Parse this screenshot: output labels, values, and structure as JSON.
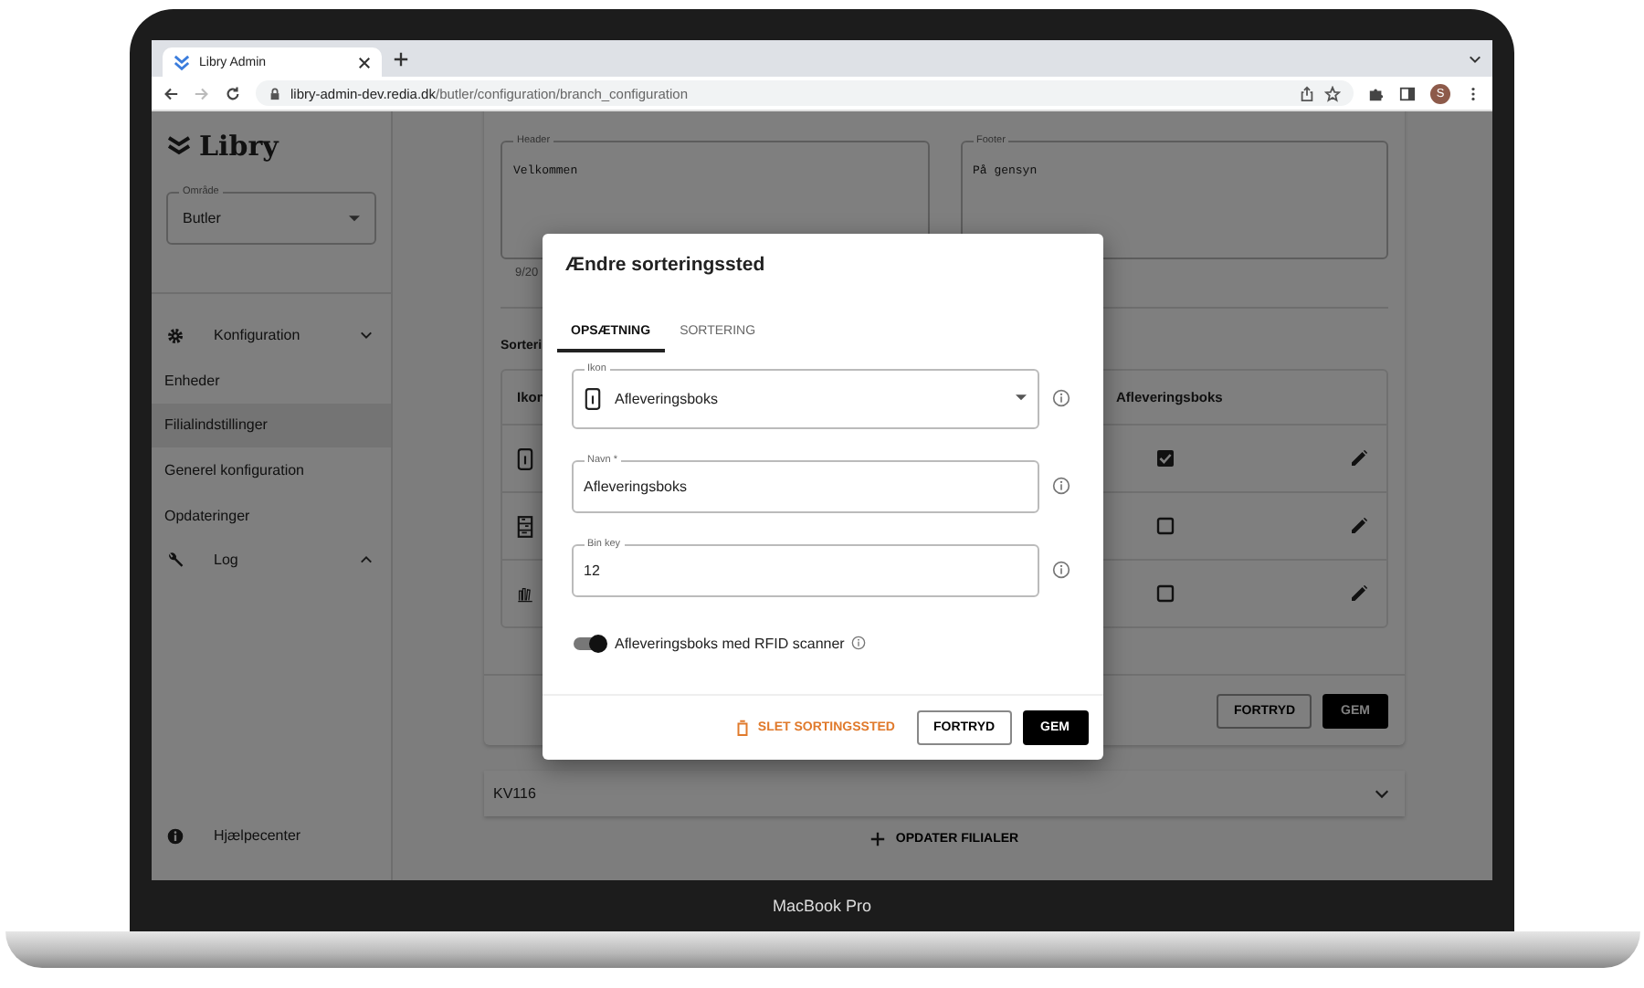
{
  "browser": {
    "tab_title": "Libry Admin",
    "url_host": "libry-admin-dev.redia.dk",
    "url_path": "/butler/configuration/branch_configuration",
    "avatar": "S"
  },
  "sidebar": {
    "logo": "Libry",
    "area_field": {
      "label": "Område",
      "value": "Butler"
    },
    "nav": [
      {
        "label": "Konfiguration",
        "expanded": true,
        "children": [
          {
            "label": "Enheder",
            "selected": false
          },
          {
            "label": "Filialindstillinger",
            "selected": true
          },
          {
            "label": "Generel konfiguration",
            "selected": false
          },
          {
            "label": "Opdateringer",
            "selected": false
          }
        ]
      },
      {
        "label": "Log",
        "expanded": false
      }
    ],
    "help": "Hjælpecenter"
  },
  "main": {
    "header_field": {
      "label": "Header",
      "value": "Velkommen"
    },
    "footer_field": {
      "label": "Footer",
      "value": "På gensyn"
    },
    "counter": "9/20",
    "section_title": "Sorteri",
    "table": {
      "columns": [
        "Ikon",
        "Afleveringsboks"
      ],
      "rows": [
        {
          "checked": true
        },
        {
          "checked": false
        },
        {
          "checked": false
        }
      ]
    },
    "cancel": "FORTRYD",
    "save": "GEM",
    "accordion": "KV116",
    "update_button": "OPDATER FILIALER"
  },
  "dialog": {
    "title": "Ændre sorteringssted",
    "tabs": [
      {
        "label": "OPSÆTNING",
        "selected": true
      },
      {
        "label": "SORTERING",
        "selected": false
      }
    ],
    "icon_select": {
      "label": "Ikon",
      "value": "Afleveringsboks"
    },
    "name_field": {
      "label": "Navn *",
      "value": "Afleveringsboks"
    },
    "bin_key_field": {
      "label": "Bin key",
      "value": "12"
    },
    "toggle": {
      "label": "Afleveringsboks med RFID scanner",
      "on": true
    },
    "delete": "SLET SORTINGSSTED",
    "cancel": "FORTRYD",
    "save": "GEM"
  },
  "laptop": {
    "label": "MacBook Pro"
  }
}
